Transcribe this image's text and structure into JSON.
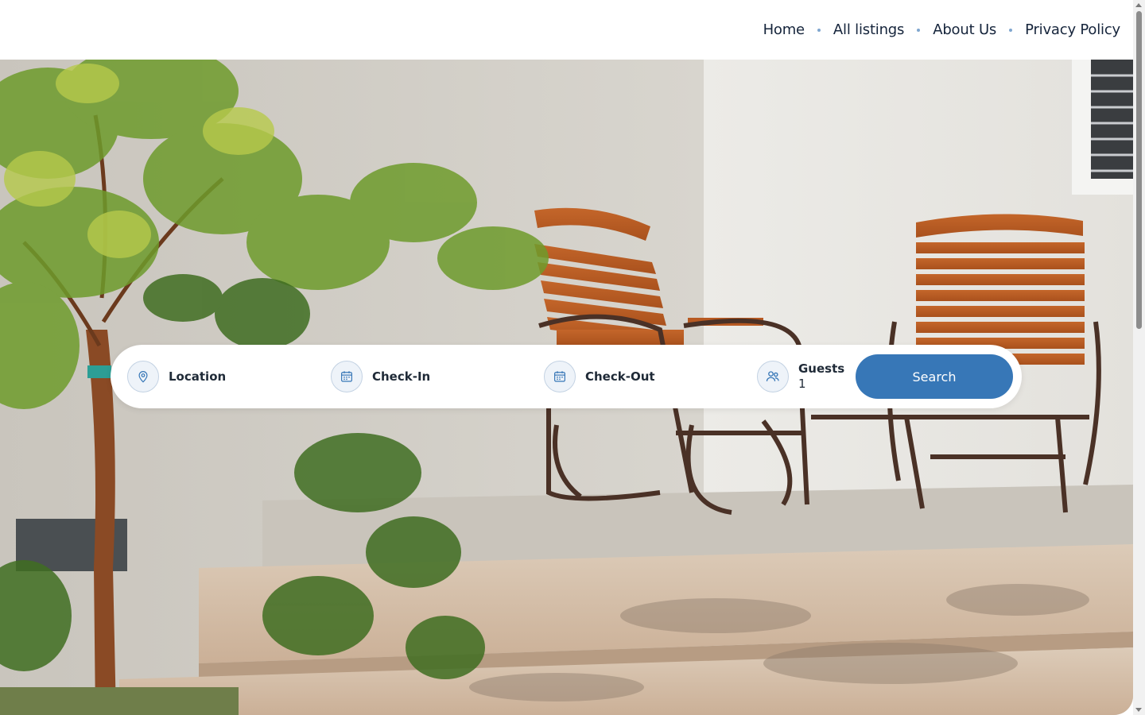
{
  "nav": {
    "items": [
      {
        "label": "Home"
      },
      {
        "label": "All listings"
      },
      {
        "label": "About Us"
      },
      {
        "label": "Privacy Policy"
      }
    ]
  },
  "hero": {
    "image": "patio-rocking-chairs-photo"
  },
  "search": {
    "location_label": "Location",
    "checkin_label": "Check-In",
    "checkout_label": "Check-Out",
    "guests_label": "Guests",
    "guests_value": "1",
    "button_label": "Search",
    "icons": {
      "location": "map-pin-icon",
      "checkin": "calendar-icon",
      "checkout": "calendar-icon",
      "guests": "users-icon"
    }
  },
  "colors": {
    "accent": "#3777b7",
    "nav_text": "#15243b",
    "nav_dot": "#7fa6cf",
    "icon_bg": "#eef3f9"
  }
}
